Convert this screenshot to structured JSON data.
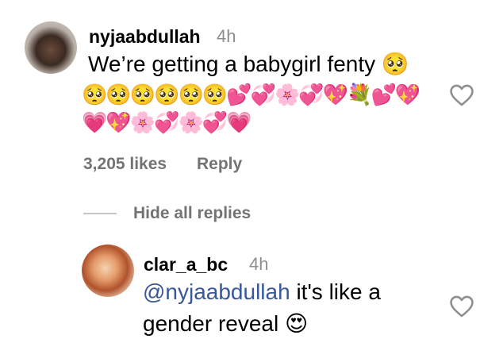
{
  "comment": {
    "username": "nyjaabdullah",
    "time": "4h",
    "text": "We’re getting a babygirl fenty",
    "text_emoji": "🥺",
    "emoji_line1": "🥺🥺🥺🥺🥺🥺💕💞🌸💞💖💐💕💖",
    "emoji_line2": "💗💖🌸💞🌸💞💗",
    "likes": "3,205 likes",
    "reply_label": "Reply",
    "hide_replies_label": "Hide all replies"
  },
  "reply": {
    "username": "clar_a_bc",
    "time": "4h",
    "mention": "@nyjaabdullah",
    "text_line1": " it's like a",
    "text_line2": "gender reveal",
    "text_emoji": "😍"
  },
  "icons": {
    "avatar": "avatar",
    "like": "heart-outline-icon"
  }
}
